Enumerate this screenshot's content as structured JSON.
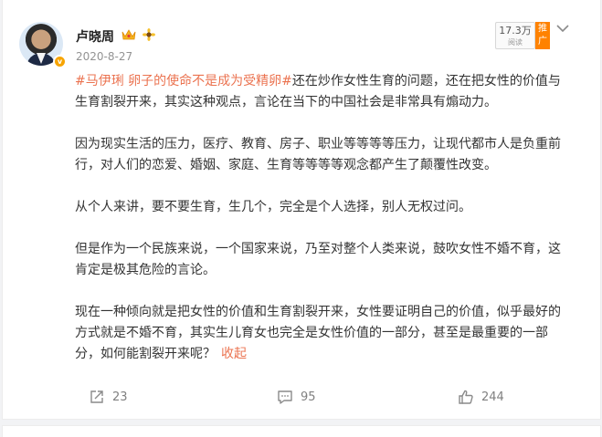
{
  "post": {
    "username": "卢晓周",
    "verified_badge": "v",
    "date": "2020-8-27",
    "read_count": "17.3万",
    "read_label": "阅读",
    "promo_label": "推广",
    "hashtag": "#马伊琍 卵子的使命不是成为受精卵#",
    "paragraphs": [
      "还在炒作女性生育的问题，还在把女性的价值与生育割裂开来，其实这种观点，言论在当下的中国社会是非常具有煽动力。",
      "因为现实生活的压力，医疗、教育、房子、职业等等等等压力，让现代都市人是负重前行，对人们的恋爱、婚姻、家庭、生育等等等等观念都产生了颠覆性改变。",
      "从个人来讲，要不要生育，生几个，完全是个人选择，别人无权过问。",
      "但是作为一个民族来说，一个国家来说，乃至对整个人类来说，鼓吹女性不婚不育，这肯定是极其危险的言论。",
      "现在一种倾向就是把女性的价值和生育割裂开来，女性要证明自己的价值，似乎最好的方式就是不婚不育，其实生儿育女也完全是女性价值的一部分，甚至是最重要的一部分，如何能割裂开来呢？"
    ],
    "collapse_label": "收起",
    "repost_count": "23",
    "comment_count": "95",
    "like_count": "244"
  },
  "icons": {
    "badge": "crown-icon",
    "emoji": "sunflower-icon",
    "menu": "chevron-down-icon",
    "repost": "repost-icon",
    "comment": "comment-icon",
    "like": "thumbs-up-icon"
  },
  "colors": {
    "accent": "#eb7350",
    "promo": "#ff8200",
    "verified": "#f7a400"
  }
}
